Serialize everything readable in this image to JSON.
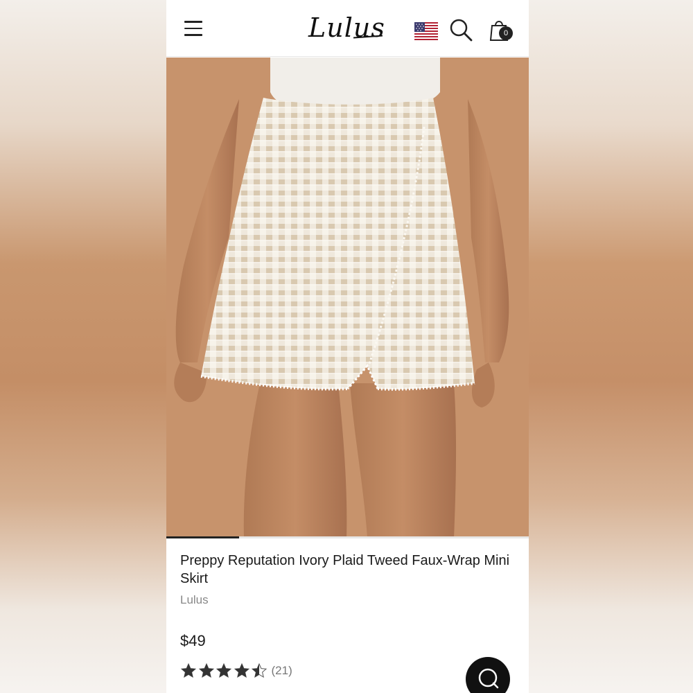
{
  "header": {
    "logo_text": "Lulus",
    "cart_count": "0",
    "menu_icon": "hamburger-menu-icon",
    "flag_icon": "us-flag-icon",
    "search_icon": "search-icon",
    "bag_icon": "shopping-bag-icon"
  },
  "gallery": {
    "progress": 0.2
  },
  "product": {
    "title": "Preppy Reputation Ivory Plaid Tweed Faux-Wrap Mini Skirt",
    "brand": "Lulus",
    "price": "$49",
    "rating": 4.5,
    "review_count": "(21)"
  },
  "colors": {
    "text_primary": "#1a1a1a",
    "text_secondary": "#888888",
    "accent_dark": "#111111",
    "hero_background": "#c6916a"
  },
  "chat": {
    "icon": "chat-icon"
  }
}
